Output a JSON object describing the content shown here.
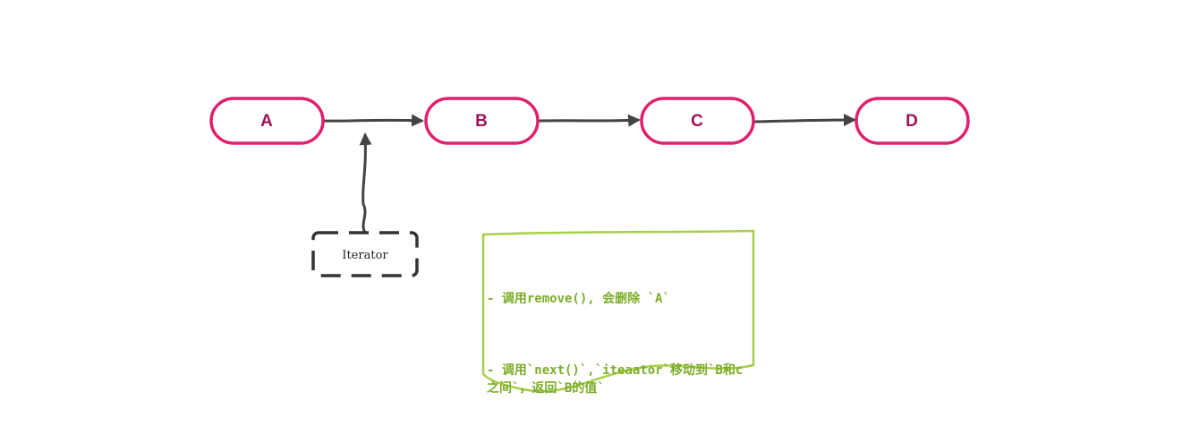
{
  "nodes": [
    {
      "id": "A",
      "label": "A"
    },
    {
      "id": "B",
      "label": "B"
    },
    {
      "id": "C",
      "label": "C"
    },
    {
      "id": "D",
      "label": "D"
    }
  ],
  "edges": [
    {
      "from": "A",
      "to": "B"
    },
    {
      "from": "B",
      "to": "C"
    },
    {
      "from": "C",
      "to": "D"
    }
  ],
  "iterator": {
    "label": "Iterator",
    "points_to": "A-B edge"
  },
  "note": {
    "line1": "- 调用remove(), 会删除 `A`",
    "line2": "- 调用`next()`,`iteaator`移动到`B和c之间`，返回`B的值`"
  },
  "colors": {
    "node_border": "#e0206e",
    "node_text": "#9b1458",
    "arrow": "#444444",
    "note_border": "#a8cf4a",
    "note_text": "#7cad2a",
    "iterator_border": "#333333"
  }
}
